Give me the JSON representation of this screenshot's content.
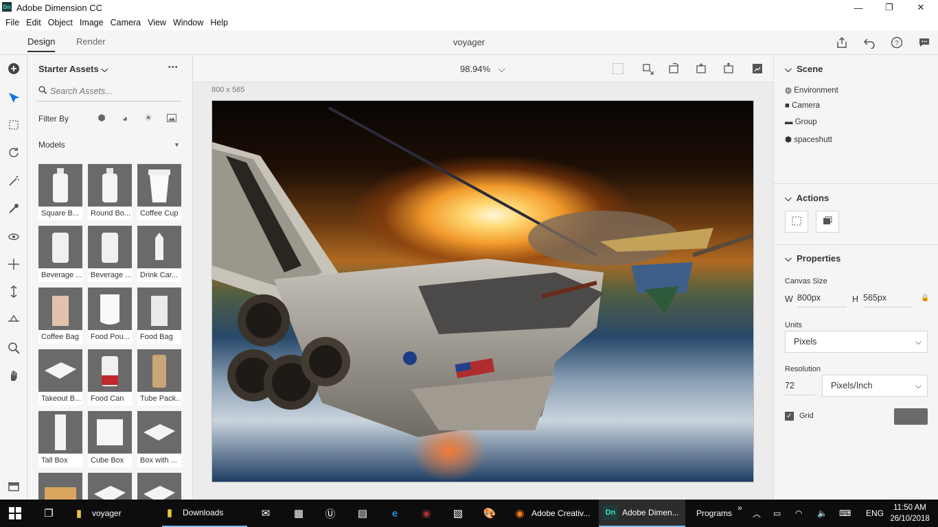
{
  "window": {
    "title": "Adobe Dimension CC",
    "icon_text": "Dn",
    "minimize": "—",
    "restore": "❐",
    "close": "✕"
  },
  "menu": [
    "File",
    "Edit",
    "Object",
    "Image",
    "Camera",
    "View",
    "Window",
    "Help"
  ],
  "tabs": {
    "design": "Design",
    "render": "Render"
  },
  "document_title": "voyager",
  "top_icons": [
    "share-icon",
    "undo-icon",
    "help-icon",
    "chat-icon"
  ],
  "tools": [
    "add-icon",
    "select-icon",
    "transform-icon",
    "rotate-icon",
    "magic-wand-icon",
    "sample-icon",
    "orbit-icon",
    "pan-icon",
    "dolly-icon",
    "horizon-icon",
    "zoom-icon",
    "hand-icon"
  ],
  "assets": {
    "title": "Starter Assets",
    "more": "•••",
    "search_placeholder": "Search Assets...",
    "filter_label": "Filter By",
    "filter_icons": [
      "model-filter-icon",
      "material-filter-icon",
      "light-filter-icon",
      "image-filter-icon"
    ],
    "models_label": "Models",
    "items": [
      {
        "label": "Square B..."
      },
      {
        "label": "Round Bo..."
      },
      {
        "label": "Coffee Cup"
      },
      {
        "label": "Beverage ..."
      },
      {
        "label": "Beverage ..."
      },
      {
        "label": "Drink Car..."
      },
      {
        "label": "Coffee Bag"
      },
      {
        "label": "Food Pou..."
      },
      {
        "label": "Food Bag"
      },
      {
        "label": "Takeout B..."
      },
      {
        "label": "Food Can"
      },
      {
        "label": "Tube Pack.."
      },
      {
        "label": "Tall Box"
      },
      {
        "label": "Cube Box"
      },
      {
        "label": "Box with ..."
      },
      {
        "label": ""
      },
      {
        "label": ""
      },
      {
        "label": ""
      }
    ]
  },
  "canvas": {
    "zoom": "98.94%",
    "size_label": "800 x 565",
    "view_icons": [
      "frame-icon",
      "fit-icon",
      "rotate-view-icon",
      "pan-view-icon",
      "dolly-view-icon",
      "render-preview-icon"
    ]
  },
  "scene": {
    "title": "Scene",
    "items": [
      {
        "label": "Environment",
        "icon": "environment-icon"
      },
      {
        "label": "Camera",
        "icon": "camera-icon"
      },
      {
        "label": "Group",
        "icon": "folder-icon"
      },
      {
        "label": "spaceshutt",
        "icon": "model-icon"
      }
    ]
  },
  "actions": {
    "title": "Actions"
  },
  "properties": {
    "title": "Properties",
    "canvas_size_label": "Canvas Size",
    "w_label": "W",
    "w_value": "800px",
    "h_label": "H",
    "h_value": "565px",
    "units_label": "Units",
    "units_value": "Pixels",
    "resolution_label": "Resolution",
    "resolution_value": "72",
    "resolution_unit": "Pixels/Inch",
    "grid_label": "Grid",
    "grid_checked": true,
    "grid_color": "#6a6a6a"
  },
  "taskbar": {
    "items": [
      {
        "label": "voyager",
        "icon": "folder-icon"
      },
      {
        "label": "Downloads",
        "icon": "folder-icon"
      },
      {
        "label": "Adobe Creativ...",
        "icon": "firefox-icon"
      },
      {
        "label": "Adobe Dimen...",
        "icon": "dimension-icon"
      }
    ],
    "programs": "Programs",
    "programs_chevron": "»",
    "lang": "ENG",
    "time": "11:50 AM",
    "date": "26/10/2018"
  },
  "colors": {
    "accent": "#1473e6",
    "taskbar_bg": "#0d0d0d",
    "panel_bg": "#f5f5f5"
  }
}
